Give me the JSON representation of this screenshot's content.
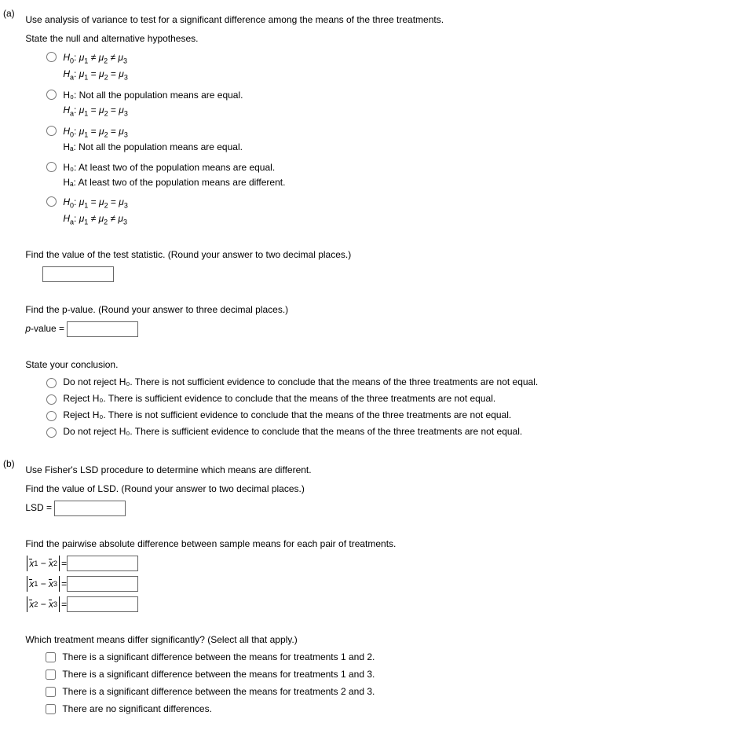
{
  "partA": {
    "label": "(a)",
    "intro": "Use analysis of variance to test for a significant difference among the means of the three treatments.",
    "hyp_prompt": "State the null and alternative hypotheses.",
    "options": [
      {
        "h0": "H₀: μ₁ ≠ μ₂ ≠ μ₃",
        "ha": "Hₐ: μ₁ = μ₂ = μ₃"
      },
      {
        "h0": "H₀: Not all the population means are equal.",
        "ha": "Hₐ: μ₁ = μ₂ = μ₃"
      },
      {
        "h0": "H₀: μ₁ = μ₂ = μ₃",
        "ha": "Hₐ: Not all the population means are equal."
      },
      {
        "h0": "H₀: At least two of the population means are equal.",
        "ha": "Hₐ: At least two of the population means are different."
      },
      {
        "h0": "H₀: μ₁ = μ₂ = μ₃",
        "ha": "Hₐ: μ₁ ≠ μ₂ ≠ μ₃"
      }
    ],
    "teststat_prompt": "Find the value of the test statistic. (Round your answer to two decimal places.)",
    "pvalue_prompt": "Find the p-value. (Round your answer to three decimal places.)",
    "pvalue_label": "p-value =",
    "conclusion_prompt": "State your conclusion.",
    "conclusions": [
      "Do not reject H₀. There is not sufficient evidence to conclude that the means of the three treatments are not equal.",
      "Reject H₀. There is sufficient evidence to conclude that the means of the three treatments are not equal.",
      "Reject H₀. There is not sufficient evidence to conclude that the means of the three treatments are not equal.",
      "Do not reject H₀. There is sufficient evidence to conclude that the means of the three treatments are not equal."
    ]
  },
  "partB": {
    "label": "(b)",
    "intro": "Use Fisher's LSD procedure to determine which means are different.",
    "lsd_prompt": "Find the value of LSD. (Round your answer to two decimal places.)",
    "lsd_label": "LSD =",
    "pairwise_prompt": "Find the pairwise absolute difference between sample means for each pair of treatments.",
    "pairs": [
      {
        "i": "1",
        "j": "2"
      },
      {
        "i": "1",
        "j": "3"
      },
      {
        "i": "2",
        "j": "3"
      }
    ],
    "eq": " = ",
    "which_prompt": "Which treatment means differ significantly? (Select all that apply.)",
    "checks": [
      "There is a significant difference between the means for treatments 1 and 2.",
      "There is a significant difference between the means for treatments 1 and 3.",
      "There is a significant difference between the means for treatments 2 and 3.",
      "There are no significant differences."
    ]
  }
}
